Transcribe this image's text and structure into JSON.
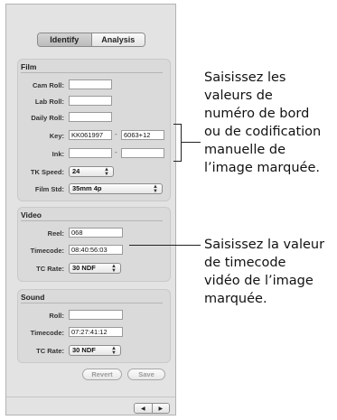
{
  "tabs": [
    {
      "label": "Identify",
      "active": true
    },
    {
      "label": "Analysis",
      "active": false
    }
  ],
  "film": {
    "title": "Film",
    "cam_roll_label": "Cam Roll:",
    "cam_roll_value": "",
    "lab_roll_label": "Lab Roll:",
    "lab_roll_value": "",
    "daily_roll_label": "Daily Roll:",
    "daily_roll_value": "",
    "key_label": "Key:",
    "key_prefix": "KK061997",
    "key_separator": "-",
    "key_suffix": "6063+12",
    "ink_label": "Ink:",
    "ink_prefix": "",
    "ink_separator": "-",
    "ink_suffix": "",
    "tk_speed_label": "TK Speed:",
    "tk_speed_value": "24",
    "film_std_label": "Film Std:",
    "film_std_value": "35mm 4p"
  },
  "video": {
    "title": "Video",
    "reel_label": "Reel:",
    "reel_value": "068",
    "timecode_label": "Timecode:",
    "timecode_value": "08:40:56:03",
    "tc_rate_label": "TC Rate:",
    "tc_rate_value": "30 NDF"
  },
  "sound": {
    "title": "Sound",
    "roll_label": "Roll:",
    "roll_value": "",
    "timecode_label": "Timecode:",
    "timecode_value": "07:27:41:12",
    "tc_rate_label": "TC Rate:",
    "tc_rate_value": "30 NDF"
  },
  "buttons": {
    "revert": "Revert",
    "save": "Save"
  },
  "nav": {
    "prev_icon": "triangle-left-icon",
    "next_icon": "triangle-right-icon"
  },
  "callouts": {
    "film_lines": [
      "Saisissez les",
      "valeurs de",
      "numéro de bord",
      "ou de codification",
      "manuelle de",
      "l’image marquée."
    ],
    "video_lines": [
      "Saisissez la valeur",
      "de timecode",
      "vidéo de l’image",
      "marquée."
    ]
  }
}
